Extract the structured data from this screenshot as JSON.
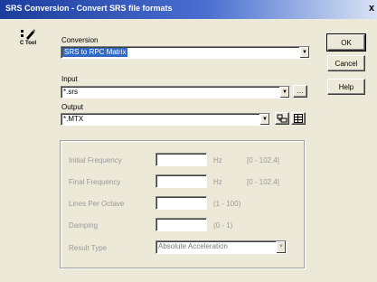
{
  "window": {
    "title": "SRS Conversion - Convert SRS file formats",
    "close_glyph": "x"
  },
  "tool": {
    "label": "C Tool",
    "icon": "pencil-arrow-icon"
  },
  "conversion": {
    "label": "Conversion",
    "value": "SRS to RPC Matrix"
  },
  "input": {
    "label": "Input",
    "value": "*.srs",
    "browse_label": "..."
  },
  "output": {
    "label": "Output",
    "value": "*.MTX"
  },
  "buttons": {
    "ok": "OK",
    "cancel": "Cancel",
    "help": "Help"
  },
  "parameters": {
    "initial_frequency": {
      "label": "Initial Frequency",
      "unit": "Hz",
      "range": "[0 - 102.4]"
    },
    "final_frequency": {
      "label": "Final Frequency",
      "unit": "Hz",
      "range": "[0 - 102.4]"
    },
    "lines_per_octave": {
      "label": "Lines Per Octave",
      "range": "(1 - 100)"
    },
    "damping": {
      "label": "Damping",
      "range": "(0 - 1)"
    },
    "result_type": {
      "label": "Result Type",
      "value": "Absolute Acceleration"
    }
  },
  "colors": {
    "title_bar": "#1c3d9e",
    "selection": "#316ac5",
    "dialog_bg": "#ece9d8",
    "disabled_text": "#9a9a9a"
  }
}
